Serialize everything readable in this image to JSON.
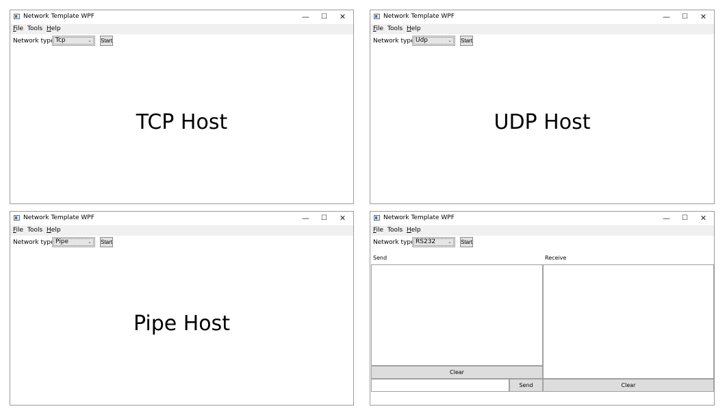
{
  "app": {
    "title": "Network Template WPF"
  },
  "window_controls": {
    "minimize": "—",
    "maximize": "☐",
    "close": "✕"
  },
  "menu": {
    "file": "File",
    "tools": "Tools",
    "help": "Help"
  },
  "toolbar": {
    "network_type_label": "Network type",
    "start_label": "Start"
  },
  "windows": [
    {
      "network_type": "Tcp",
      "host_label": "TCP Host"
    },
    {
      "network_type": "Udp",
      "host_label": "UDP Host"
    },
    {
      "network_type": "Pipe",
      "host_label": "Pipe Host"
    },
    {
      "network_type": "RS232",
      "send_label": "Send",
      "receive_label": "Receive",
      "send_clear_label": "Clear",
      "send_button_label": "Send",
      "receive_clear_label": "Clear",
      "send_input_value": ""
    }
  ]
}
